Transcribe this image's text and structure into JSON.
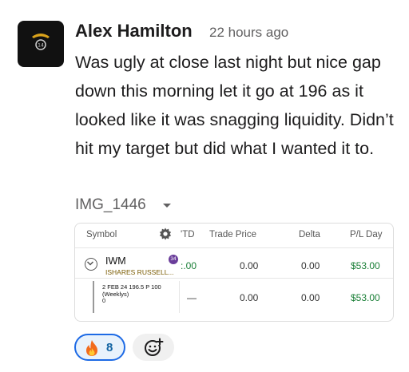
{
  "message": {
    "author": "Alex Hamilton",
    "timestamp": "22 hours ago",
    "text": "Was ugly at close last night but nice gap down this morning let it go at 196 as it looked like it was snagging liquidity. Didn’t hit my target but did what I wanted it to."
  },
  "attachment": {
    "filename": "IMG_1446",
    "table": {
      "headers": {
        "symbol": "Symbol",
        "ytd": "'TD",
        "trade_price": "Trade Price",
        "delta": "Delta",
        "pl_day": "P/L Day"
      },
      "position": {
        "symbol": "IWM",
        "badge": "34",
        "description": "ISHARES RUSSELL...",
        "ytd": ":.00",
        "trade_price": "0.00",
        "delta": "0.00",
        "pl_day": "$53.00"
      },
      "option": {
        "line1": "2 FEB 24 196.5 P 100",
        "line2": "(Weeklys)",
        "line3": "0",
        "ytd": "—",
        "trade_price": "0.00",
        "delta": "0.00",
        "pl_day": "$53.00"
      }
    }
  },
  "reactions": [
    {
      "emoji": "fire-icon",
      "count": "8",
      "selected": true
    }
  ],
  "add_reaction_icon": "add-emoji-icon",
  "colors": {
    "profit_green": "#1a7f37",
    "reaction_blue": "#1d6ae5"
  }
}
